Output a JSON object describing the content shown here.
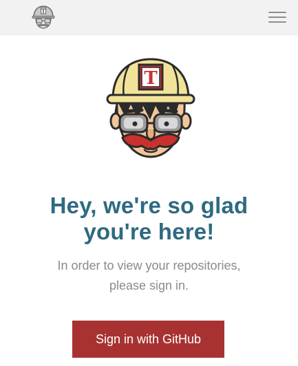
{
  "header": {
    "logo_icon": "travis-mascot-icon",
    "menu_icon": "hamburger-menu-icon"
  },
  "main": {
    "mascot_icon": "travis-mascot-icon",
    "mascot_badge_letter": "T",
    "headline_lines": [
      "Hey, we're so glad",
      "you're here!"
    ],
    "subtext_lines": [
      "In order to view your repositories,",
      "please sign in."
    ],
    "signin_label": "Sign in with GitHub"
  },
  "colors": {
    "header_bg": "#f2f2f2",
    "headline": "#2f6a80",
    "subtext": "#8a8a8a",
    "button_bg": "#a83232",
    "button_text": "#ffffff"
  }
}
